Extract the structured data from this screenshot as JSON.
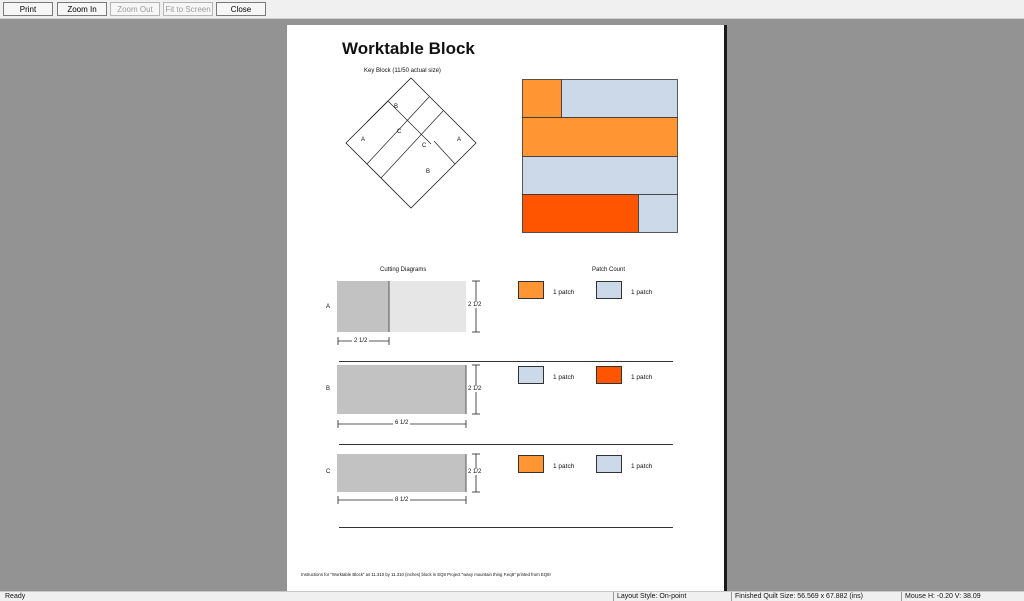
{
  "toolbar": {
    "buttons": [
      {
        "label": "Print",
        "enabled": true
      },
      {
        "label": "Zoom In",
        "enabled": true
      },
      {
        "label": "Zoom Out",
        "enabled": false
      },
      {
        "label": "Fit to Screen",
        "enabled": false
      },
      {
        "label": "Close",
        "enabled": true
      }
    ]
  },
  "page": {
    "title": "Worktable Block",
    "key_block_caption": "Key Block (11/50 actual size)",
    "key_labels": [
      "B",
      "A",
      "C",
      "C",
      "A",
      "B"
    ],
    "cutting_title": "Cutting Diagrams",
    "patch_title": "Patch Count",
    "rows": [
      {
        "label": "A",
        "height_dim": "2 1/2",
        "width_dim": "2 1/2",
        "patches": [
          {
            "color": "#ff9533",
            "text": "1 patch"
          },
          {
            "color": "#ccd9e8",
            "text": "1 patch"
          }
        ]
      },
      {
        "label": "B",
        "height_dim": "2 1/2",
        "width_dim": "6 1/2",
        "patches": [
          {
            "color": "#ccd9e8",
            "text": "1 patch"
          },
          {
            "color": "#ff5500",
            "text": "1 patch"
          }
        ]
      },
      {
        "label": "C",
        "height_dim": "2 1/2",
        "width_dim": "8 1/2",
        "patches": [
          {
            "color": "#ff9533",
            "text": "1 patch"
          },
          {
            "color": "#ccd9e8",
            "text": "1 patch"
          }
        ]
      }
    ],
    "footer": "Instructions for \"Worktable Block\" as 11.310 by 11.310 (inches) block in EQ8 Project \"waxy mountain thing F.eq8\" printed from EQ8!"
  },
  "colors": {
    "light_orange": "#ff9533",
    "light_blue": "#ccd9e8",
    "red_orange": "#ff5500"
  },
  "status": {
    "left": "Ready",
    "layout": "Layout Style: On-point",
    "quilt_size": "Finished Quilt Size: 56.569 x 67.882 (ins)",
    "mouse": "Mouse  H: -0.20   V: 38.09"
  }
}
